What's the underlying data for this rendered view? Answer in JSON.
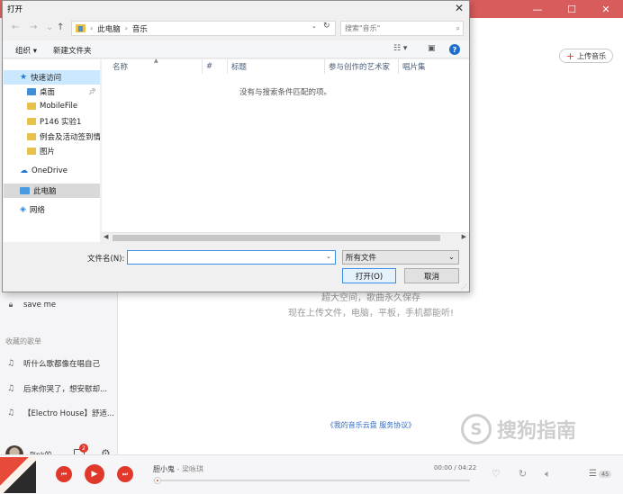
{
  "app": {
    "window_controls": [
      "—",
      "☐",
      "✕"
    ],
    "upload_button": "上传音乐",
    "cloud_line1": "超大空间，歌曲永久保存",
    "cloud_line2": "现在上传文件，电脑，平板，手机都能听!",
    "cloud_agreement": "《我的音乐云盘 服务协议》",
    "sidebar": {
      "items": [
        {
          "icon": "lock-icon",
          "label": "save me"
        }
      ],
      "collected_header": "收藏的歌单",
      "playlists": [
        {
          "label": "听什么歌都像在唱自己"
        },
        {
          "label": "后来你哭了，想安慰却..."
        },
        {
          "label": "【Electro House】舒适..."
        }
      ]
    },
    "user": {
      "name": "Pink的...",
      "badge": "2"
    },
    "player": {
      "song": "胆小鬼",
      "artist": "梁咏琪",
      "time": "00:00 / 04:22",
      "progress": 0.0,
      "playlist_count": "45"
    },
    "watermark": "搜狗指南",
    "colors": {
      "accent": "#d33a31",
      "titlebar": "#d95c5c"
    }
  },
  "dialog": {
    "title": "打开",
    "close": "✕",
    "nav": {
      "back": "←",
      "forward": "→",
      "recent": "⌄",
      "up": "↑"
    },
    "address": {
      "segments": [
        "此电脑",
        "音乐"
      ]
    },
    "search_placeholder": "搜索\"音乐\"",
    "commands": {
      "organize": "组织 ▾",
      "new_folder": "新建文件夹"
    },
    "help": "?",
    "nav_pane": [
      {
        "label": "快速访问",
        "type": "quick"
      },
      {
        "label": "桌面",
        "type": "desktop"
      },
      {
        "label": "MobileFile",
        "type": "folder"
      },
      {
        "label": "P146 实验1",
        "type": "folder"
      },
      {
        "label": "例会及活动签到情况",
        "type": "folder"
      },
      {
        "label": "图片",
        "type": "folder"
      },
      {
        "label": "OneDrive",
        "type": "onedrive"
      },
      {
        "label": "此电脑",
        "type": "pc"
      },
      {
        "label": "网络",
        "type": "network"
      }
    ],
    "columns": [
      "名称",
      "#",
      "标题",
      "参与创作的艺术家",
      "唱片集"
    ],
    "empty_message": "没有与搜索条件匹配的项。",
    "filename_label": "文件名(N):",
    "filename_value": "",
    "filetype_value": "所有文件",
    "open_button": "打开(O)",
    "cancel_button": "取消"
  }
}
